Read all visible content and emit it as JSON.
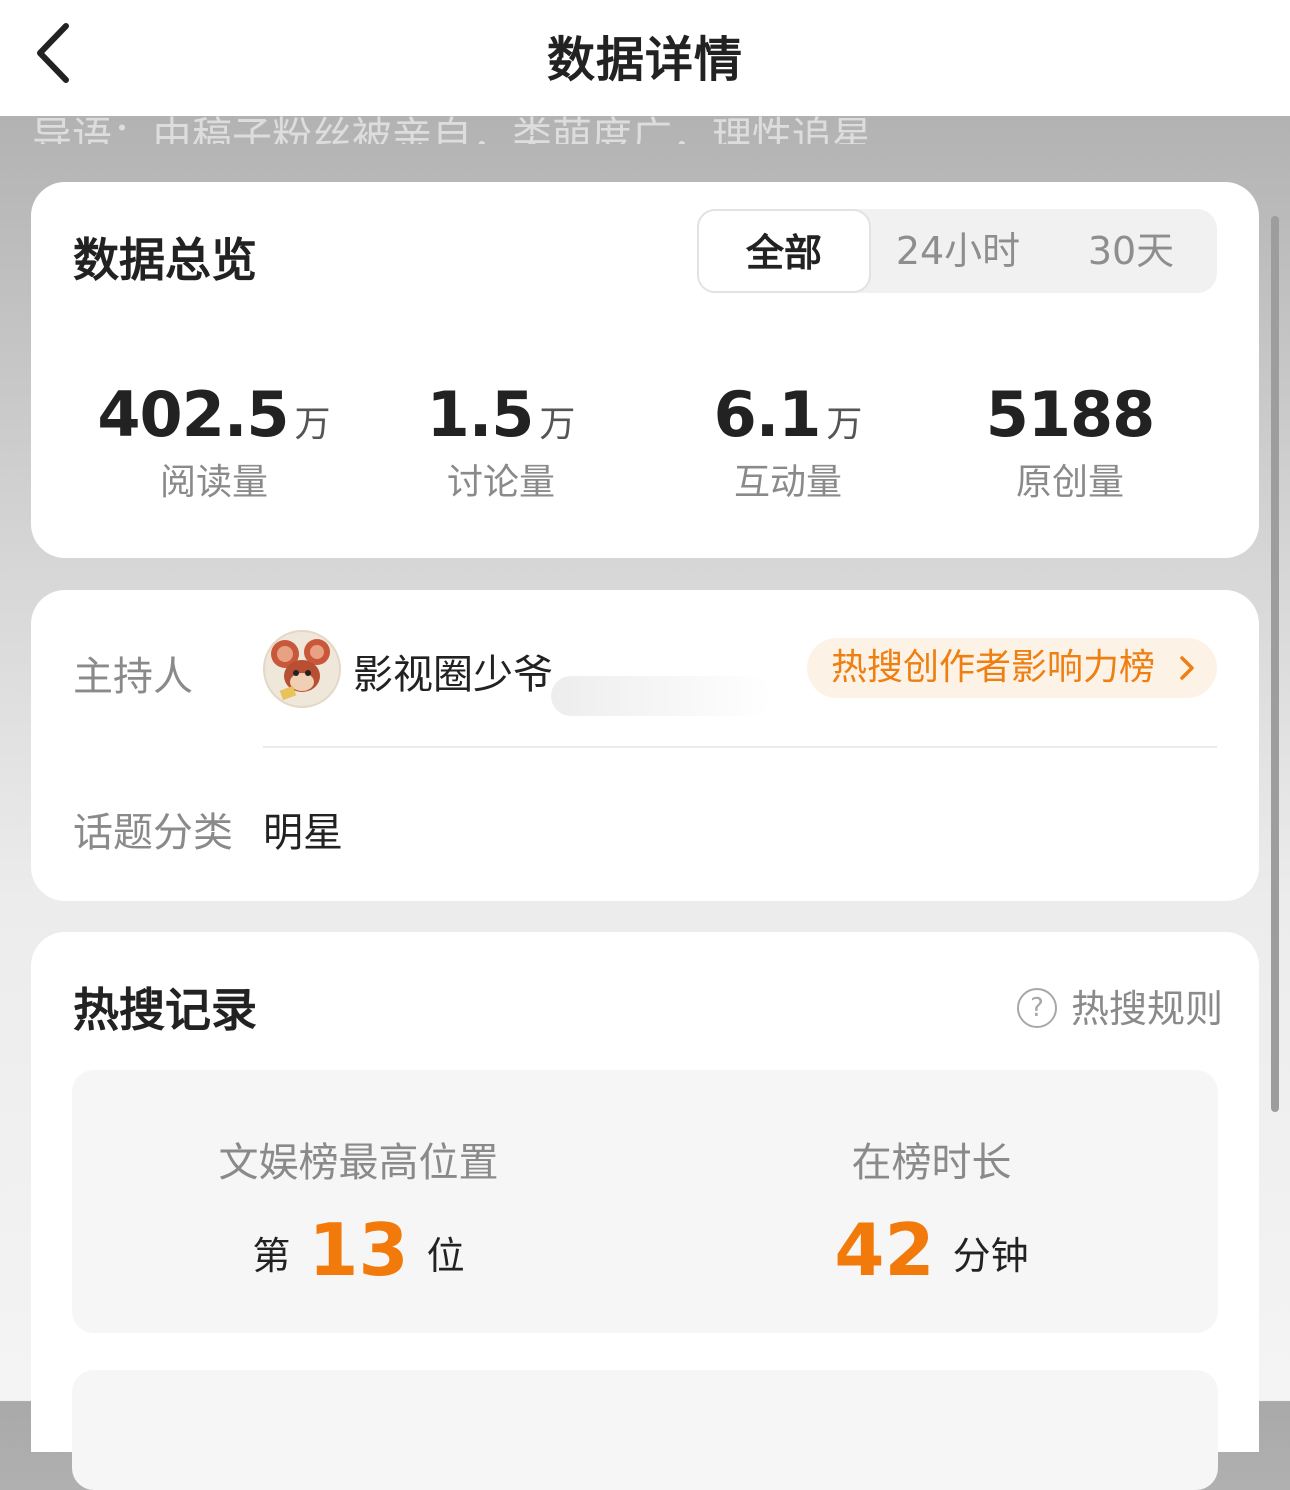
{
  "nav": {
    "title": "数据详情"
  },
  "behind_text": "导语：由稿子粉丝被亲自，类萌度广，理性追星",
  "overview": {
    "title": "数据总览",
    "tabs": [
      {
        "label": "全部",
        "active": true
      },
      {
        "label": "24小时",
        "active": false
      },
      {
        "label": "30天",
        "active": false
      }
    ],
    "stats": [
      {
        "value": "402.5",
        "unit": "万",
        "label": "阅读量"
      },
      {
        "value": "1.5",
        "unit": "万",
        "label": "讨论量"
      },
      {
        "value": "6.1",
        "unit": "万",
        "label": "互动量"
      },
      {
        "value": "5188",
        "unit": "",
        "label": "原创量"
      }
    ]
  },
  "host": {
    "label": "主持人",
    "name": "影视圈少爷",
    "rank_link": "热搜创作者影响力榜",
    "category_label": "话题分类",
    "category_value": "明星"
  },
  "hot": {
    "title": "热搜记录",
    "rules_link": "热搜规则",
    "best_position": {
      "label": "文娱榜最高位置",
      "prefix": "第",
      "value": "13",
      "suffix": "位"
    },
    "duration": {
      "label": "在榜时长",
      "value": "42",
      "suffix": "分钟"
    }
  },
  "colors": {
    "accent": "#f27a0b",
    "pill_bg": "#fdf2e6"
  }
}
